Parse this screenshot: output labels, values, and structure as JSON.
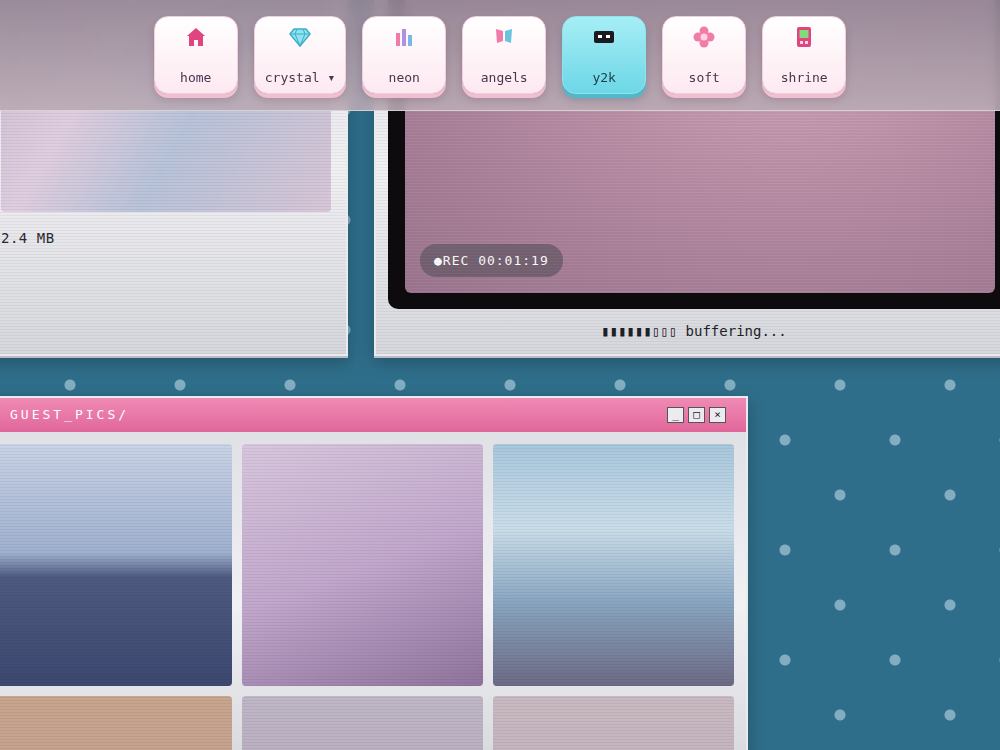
{
  "nav": [
    {
      "label": "home",
      "selected": false
    },
    {
      "label": "crystal ▾",
      "selected": false
    },
    {
      "label": "neon",
      "selected": false
    },
    {
      "label": "angels",
      "selected": false
    },
    {
      "label": "y2k",
      "selected": true
    },
    {
      "label": "soft",
      "selected": false
    },
    {
      "label": "shrine",
      "selected": false
    }
  ],
  "file_window": {
    "size": "2.4 MB"
  },
  "video_window": {
    "rec": "●REC 00:01:19",
    "status": "▮▮▮▮▮▮▯▯▯ buffering..."
  },
  "guest_pics": {
    "title": "GUEST_PICS/",
    "controls": [
      "_",
      "□",
      "×"
    ]
  }
}
